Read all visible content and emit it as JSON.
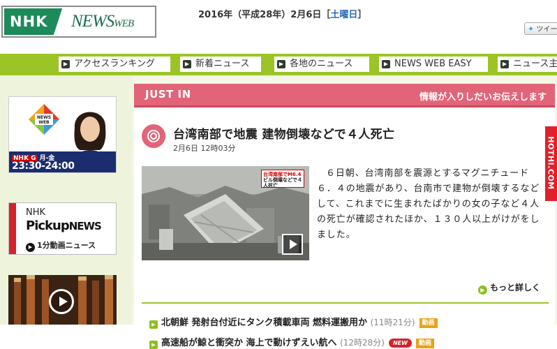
{
  "header": {
    "logo_nhk": "NHK",
    "logo_news": "NEWS",
    "logo_web": "WEB",
    "date_prefix": "2016年（平成28年）2月6日［",
    "day_of_week": "土曜日",
    "date_suffix": "］",
    "tweet_label": "ツイー"
  },
  "nav": {
    "items": [
      {
        "label": "アクセスランキング"
      },
      {
        "label": "新着ニュース"
      },
      {
        "label": "各地のニュース"
      },
      {
        "label": "NEWS WEB EASY"
      },
      {
        "label": "ニュース主"
      }
    ]
  },
  "left": {
    "news_badge_1": "NEWS",
    "news_badge_2": "WEB",
    "schedule_channel": "NHK G",
    "schedule_days": "月-金",
    "schedule_time": "23:30-24:00",
    "pickup_nhk": "NHK",
    "pickup_word": "Pickup",
    "pickup_news": "NEWS",
    "pickup_sub": "1分動画ニュース"
  },
  "main": {
    "just_in_label": "JUST IN",
    "just_in_right": "情報が入りしだいお伝えします",
    "headline": "台湾南部で地震 建物倒壊などで４人死亡",
    "timestamp": "2月6日 12時03分",
    "photo_caption_1": "台湾南部でM6.4",
    "photo_caption_2": "ビル倒壊などで４人死亡",
    "summary": "６日朝、台湾南部を震源とするマグニチュード６．４の地震があり、台南市で建物が倒壊するなどして、これまでに生まれたばかりの女の子など４人の死亡が確認されたほか、１３０人以上がけがをしました。",
    "more_label": "もっと詳しく",
    "side_tab": "HOTHI.COM",
    "news_list": [
      {
        "title": "北朝鮮 発射台付近にタンク積載車両 燃料運搬用か",
        "time": "(11時21分)",
        "new_badge": "",
        "video_badge": "動画"
      },
      {
        "title": "高速船が鯨と衝突か 海上で動けずえい航へ",
        "time": "(12時28分)",
        "new_badge": "NEW",
        "video_badge": "動画"
      }
    ]
  },
  "colors": {
    "nav_green": "#9bc526",
    "justin_pink": "#e26478",
    "nhk_green": "#1d8a5a",
    "accent_green": "#8cbf1f"
  }
}
